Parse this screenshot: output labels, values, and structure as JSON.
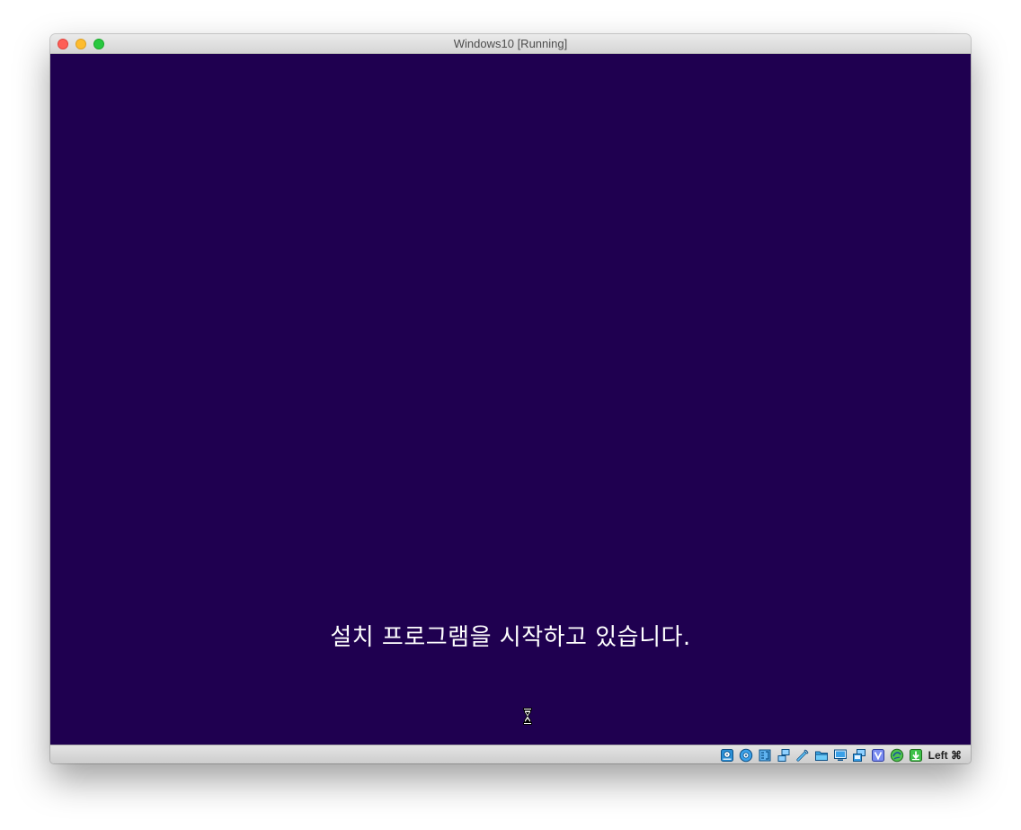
{
  "window": {
    "title": "Windows10 [Running]"
  },
  "vm": {
    "background_color": "#1f0050",
    "setup_message": "설치 프로그램을 시작하고 있습니다.",
    "cursor": "hourglass-cursor-icon"
  },
  "statusbar": {
    "icons": [
      "hard-disk-icon",
      "optical-drive-icon",
      "audio-icon",
      "network-icon",
      "usb-icon",
      "shared-folder-icon",
      "display-icon",
      "video-capture-icon",
      "virtualization-icon",
      "mouse-integration-icon",
      "download-icon"
    ],
    "host_key": "Left ⌘"
  }
}
